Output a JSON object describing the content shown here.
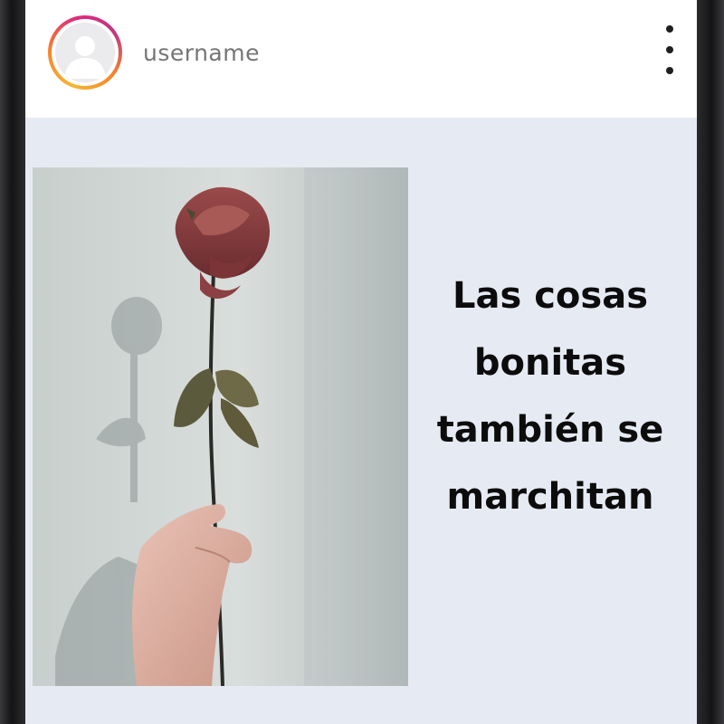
{
  "header": {
    "username": "username",
    "avatar_icon": "default-user-avatar",
    "menu_icon": "more-vertical-icon"
  },
  "post": {
    "image_subject": "hand-holding-dried-rose",
    "caption": "Las cosas bonitas también se marchitan"
  },
  "colors": {
    "screen_background": "#e6ebf3",
    "header_background": "#ffffff",
    "username_text": "#757575",
    "caption_text": "#0c0c0c",
    "phone_frame": "#1f1f21"
  }
}
